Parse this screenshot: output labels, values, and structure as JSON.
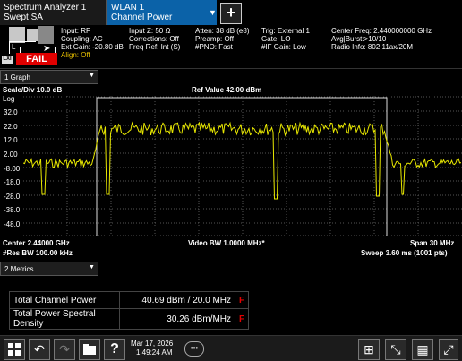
{
  "tabs": {
    "analyzer_title": "Spectrum Analyzer 1",
    "analyzer_mode": "Swept SA",
    "wlan_title": "WLAN 1",
    "wlan_mode": "Channel Power"
  },
  "status": {
    "fail_label": "FAIL",
    "lxi_label": "LXI",
    "col1": [
      "Input: RF",
      "Coupling: AC",
      "Ext Gain: -20.80 dB",
      "Align: Off"
    ],
    "col2": [
      "Input Z: 50 Ω",
      "Corrections: Off",
      "Freq Ref: Int (S)"
    ],
    "col3": [
      "Atten: 38 dB (e8)",
      "Preamp: Off",
      "#PNO: Fast"
    ],
    "col4": [
      "Trig: External 1",
      "Gate: LO",
      "#IF Gain: Low"
    ],
    "col5": [
      "Center Freq: 2.440000000 GHz",
      "Avg|Burst:>10/10",
      "Radio Info: 802.11ax/20M"
    ]
  },
  "graph": {
    "selector_label": "1 Graph",
    "scale": "Scale/Div 10.0 dB",
    "ref_value": "Ref Value 42.00 dBm",
    "log_label": "Log",
    "y_ticks": [
      "32.0",
      "22.0",
      "12.0",
      "2.00",
      "-8.00",
      "-18.0",
      "-28.0",
      "-38.0",
      "-48.0"
    ],
    "center": "Center 2.44000 GHz",
    "res_bw": "#Res BW 100.00 kHz",
    "video_bw": "Video BW 1.0000 MHz*",
    "span": "Span 30 MHz",
    "sweep": "Sweep 3.60 ms (1001 pts)",
    "trace_color": "#e8e800"
  },
  "metrics": {
    "selector_label": "2 Metrics",
    "rows": [
      {
        "label": "Total Channel Power",
        "value": "40.69 dBm / 20.0 MHz",
        "flag": "F"
      },
      {
        "label": "Total Power Spectral Density",
        "value": "30.26 dBm/MHz",
        "flag": "F"
      }
    ]
  },
  "taskbar": {
    "date": "Mar 17, 2026",
    "time": "1:49:24 AM"
  }
}
